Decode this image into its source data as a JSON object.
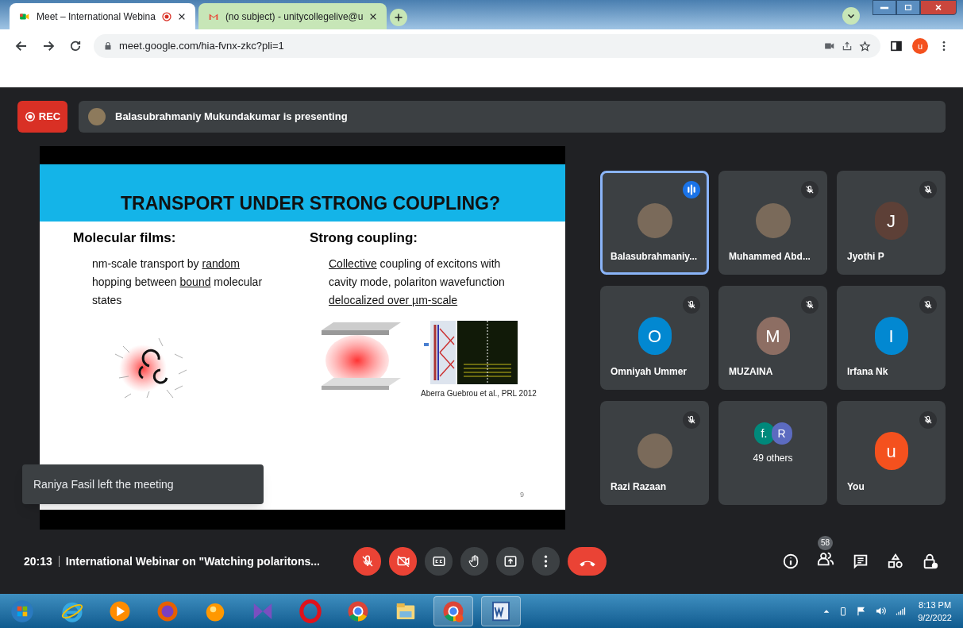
{
  "browser": {
    "tabs": [
      {
        "title": "Meet – International Webina",
        "kind": "meet",
        "recording": true,
        "selected": true
      },
      {
        "title": "(no subject) - unitycollegelive@u",
        "kind": "mail",
        "recording": false,
        "selected": false
      }
    ],
    "address": "meet.google.com/hia-fvnx-zkc?pli=1",
    "profile_initial": "u"
  },
  "meet": {
    "rec_label": "REC",
    "presenter": "Balasubrahmaniy Mukundakumar is presenting",
    "slide": {
      "title": "TRANSPORT UNDER STRONG COUPLING?",
      "columns": [
        {
          "heading": "Molecular films:",
          "segments": [
            {
              "text": "nm-scale transport by ",
              "underline": false
            },
            {
              "text": "random",
              "underline": true
            },
            {
              "text": " hopping between ",
              "underline": false
            },
            {
              "text": "bound",
              "underline": true
            },
            {
              "text": " molecular states",
              "underline": false
            }
          ]
        },
        {
          "heading": "Strong coupling:",
          "segments": [
            {
              "text": "Collective",
              "underline": true
            },
            {
              "text": " coupling of excitons with cavity mode, polariton wavefunction ",
              "underline": false
            },
            {
              "text": "delocalized over µm-scale",
              "underline": true
            }
          ]
        }
      ],
      "citation": "Aberra Guebrou et al., PRL 2012",
      "page_number": "9"
    },
    "toast": "Raniya Fasil left the meeting",
    "tiles": [
      {
        "name": "Balasubrahmaniy...",
        "kind": "photo",
        "speaking": true,
        "muted": false,
        "selected": true
      },
      {
        "name": "Muhammed Abd...",
        "kind": "photo",
        "speaking": false,
        "muted": true,
        "selected": false
      },
      {
        "name": "Jyothi P",
        "kind": "initial",
        "initial": "J",
        "color": "#5d4037",
        "speaking": false,
        "muted": true,
        "selected": false
      },
      {
        "name": "Omniyah Ummer",
        "kind": "initial",
        "initial": "O",
        "color": "#0288d1",
        "speaking": false,
        "muted": true,
        "selected": false
      },
      {
        "name": "MUZAINA",
        "kind": "initial",
        "initial": "M",
        "color": "#8d6e63",
        "speaking": false,
        "muted": true,
        "selected": false
      },
      {
        "name": "Irfana Nk",
        "kind": "initial",
        "initial": "I",
        "color": "#0288d1",
        "speaking": false,
        "muted": true,
        "selected": false
      },
      {
        "name": "Razi Razaan",
        "kind": "photo",
        "speaking": false,
        "muted": true,
        "selected": false
      },
      {
        "name": "49 others",
        "kind": "group",
        "group": [
          {
            "initial": "f.",
            "color": "#00897b"
          },
          {
            "initial": "R",
            "color": "#5c6bc0"
          }
        ],
        "speaking": false,
        "muted": false,
        "selected": false
      },
      {
        "name": "You",
        "kind": "initial",
        "initial": "u",
        "color": "#f4511e",
        "speaking": false,
        "muted": true,
        "selected": false
      }
    ],
    "time": "20:13",
    "meeting_title": "International Webinar on \"Watching polaritons...",
    "controls": [
      {
        "kind": "mic",
        "off": true
      },
      {
        "kind": "camera",
        "off": true
      },
      {
        "kind": "captions",
        "off": false
      },
      {
        "kind": "hand",
        "off": false
      },
      {
        "kind": "present",
        "off": false
      },
      {
        "kind": "more",
        "off": false
      },
      {
        "kind": "leave"
      }
    ],
    "participant_count": "58"
  },
  "taskbar": {
    "apps": [
      {
        "kind": "start"
      },
      {
        "kind": "ie"
      },
      {
        "kind": "media"
      },
      {
        "kind": "firefox"
      },
      {
        "kind": "vlc"
      },
      {
        "kind": "vs"
      },
      {
        "kind": "opera"
      },
      {
        "kind": "chrome"
      },
      {
        "kind": "explorer"
      },
      {
        "kind": "chrome-active"
      },
      {
        "kind": "word"
      }
    ],
    "clock_time": "8:13 PM",
    "clock_date": "9/2/2022"
  }
}
